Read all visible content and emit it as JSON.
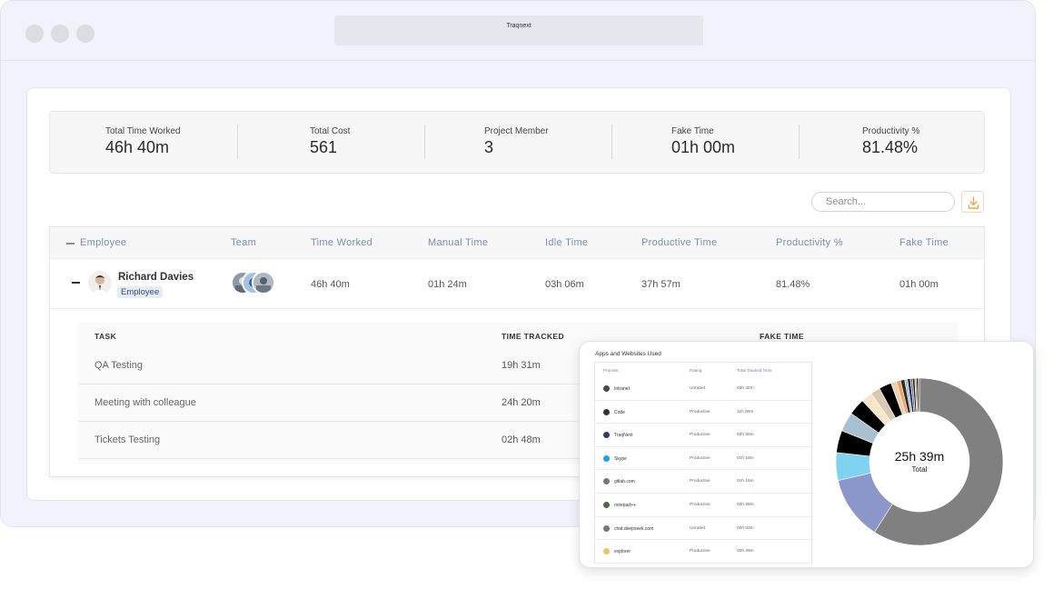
{
  "window": {
    "url_title": "Traqnext"
  },
  "stats": [
    {
      "label": "Total Time Worked",
      "value": "46h 40m"
    },
    {
      "label": "Total Cost",
      "value": "561"
    },
    {
      "label": "Project Member",
      "value": "3"
    },
    {
      "label": "Fake Time",
      "value": "01h 00m"
    },
    {
      "label": "Productivity %",
      "value": "81.48%"
    }
  ],
  "search": {
    "placeholder": "Search..."
  },
  "table": {
    "headers": {
      "employee": "Employee",
      "team": "Team",
      "time_worked": "Time Worked",
      "manual_time": "Manual Time",
      "idle_time": "Idle Time",
      "productive_time": "Productive Time",
      "productivity": "Productivity %",
      "fake_time": "Fake Time"
    },
    "row": {
      "name": "Richard Davies",
      "role": "Employee",
      "time_worked": "46h 40m",
      "manual_time": "01h 24m",
      "idle_time": "03h 06m",
      "productive_time": "37h 57m",
      "productivity": "81.48%",
      "fake_time": "01h 00m"
    }
  },
  "tasks": {
    "headers": {
      "task": "TASK",
      "time_tracked": "TIME TRACKED",
      "fake_time": "FAKE TIME"
    },
    "rows": [
      {
        "task": "QA Testing",
        "time": "19h 31m"
      },
      {
        "task": "Meeting with colleague",
        "time": "24h 20m"
      },
      {
        "task": "Tickets Testing",
        "time": "02h 48m"
      }
    ]
  },
  "apps_popup": {
    "title": "Apps and Websites Used",
    "headers": {
      "process": "Process",
      "rating": "Rating",
      "total": "Total Tracked Time"
    },
    "rows": [
      {
        "name": "Intranet",
        "rating": "Unrated",
        "time": "03h 42m",
        "color": "#4a4a4a"
      },
      {
        "name": "Code",
        "rating": "Productive",
        "time": "11h 00m",
        "color": "#333333"
      },
      {
        "name": "TraqNext",
        "rating": "Productive",
        "time": "02h 55m",
        "color": "#2c3e66"
      },
      {
        "name": "Skype",
        "rating": "Productive",
        "time": "01h 18m",
        "color": "#1aa3e8"
      },
      {
        "name": "gitlab.com",
        "rating": "Productive",
        "time": "01h 15m",
        "color": "#777777"
      },
      {
        "name": "notepad++",
        "rating": "Productive",
        "time": "00h 58m",
        "color": "#4d6b3d"
      },
      {
        "name": "chat.deepseek.com",
        "rating": "Unrated",
        "time": "00h 53m",
        "color": "#777777"
      },
      {
        "name": "explorer",
        "rating": "Productive",
        "time": "00h 39m",
        "color": "#f2c06b"
      }
    ],
    "donut": {
      "total_value": "25h 39m",
      "total_label": "Total",
      "segments": [
        {
          "value": 11.0,
          "color": "#808080"
        },
        {
          "value": 2.3,
          "color": "#8c96c8"
        },
        {
          "value": 1.0,
          "color": "#7fd3ee"
        },
        {
          "value": 0.8,
          "color": "#000000"
        },
        {
          "value": 0.7,
          "color": "#a8c0d0"
        },
        {
          "value": 0.6,
          "color": "#000000"
        },
        {
          "value": 0.4,
          "color": "#f9e6c9"
        },
        {
          "value": 0.35,
          "color": "#d9c9b4"
        },
        {
          "value": 0.45,
          "color": "#000000"
        },
        {
          "value": 0.2,
          "color": "#e8d2b4"
        },
        {
          "value": 0.15,
          "color": "#f2a05a"
        },
        {
          "value": 0.15,
          "color": "#2e2e2e"
        },
        {
          "value": 0.1,
          "color": "#a5bfd4"
        },
        {
          "value": 0.1,
          "color": "#1a1a1a"
        },
        {
          "value": 0.08,
          "color": "#6a78b0"
        },
        {
          "value": 0.08,
          "color": "#222222"
        },
        {
          "value": 0.06,
          "color": "#c9a070"
        },
        {
          "value": 0.06,
          "color": "#000000"
        },
        {
          "value": 0.05,
          "color": "#555555"
        }
      ]
    }
  },
  "colors": {
    "accent": "#7b8fb0",
    "download": "#f0a24a"
  }
}
